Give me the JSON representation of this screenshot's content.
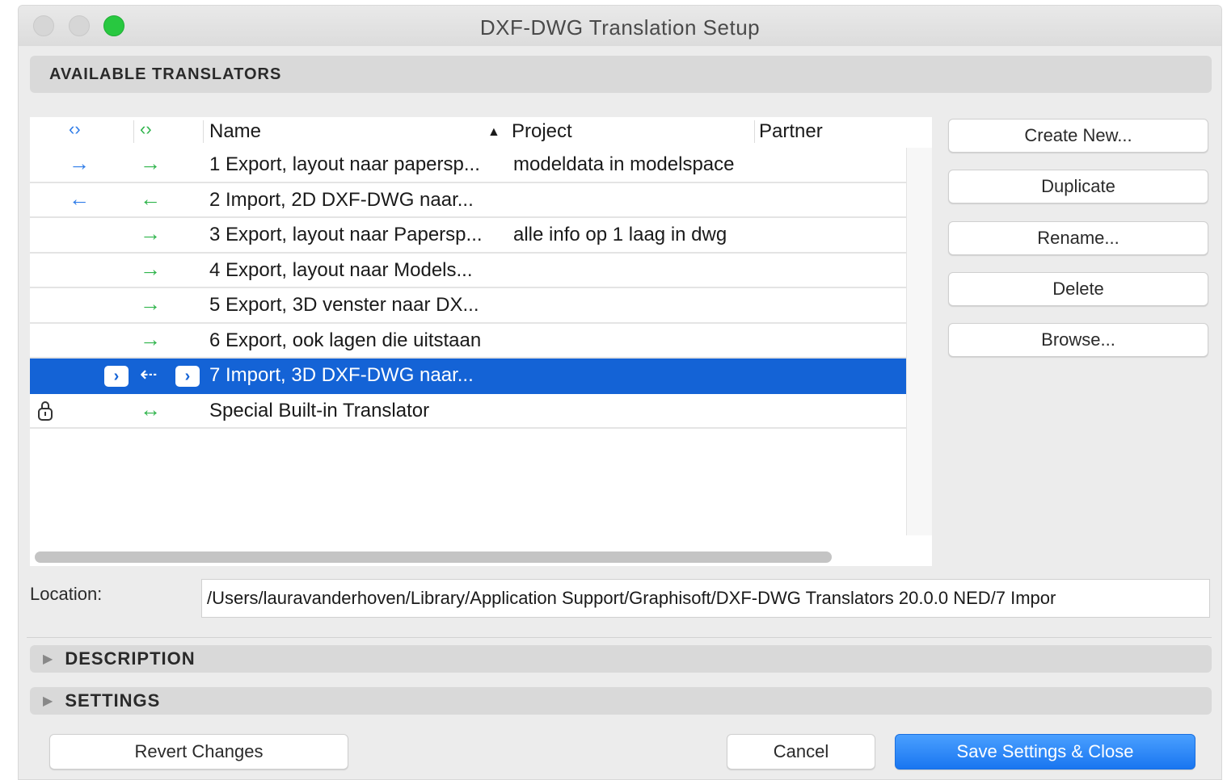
{
  "window": {
    "title": "DXF-DWG Translation Setup"
  },
  "translators": {
    "header": "AVAILABLE TRANSLATORS",
    "columns": {
      "icon1": "‹›",
      "icon2": "‹›",
      "name": "Name",
      "project": "Project",
      "partner": "Partner",
      "sort_indicator": "▲"
    },
    "rows": [
      {
        "dir1": "→",
        "dir2": "→",
        "name": "1 Export, layout naar papersp...",
        "project": "modeldata in modelspace"
      },
      {
        "dir1": "←",
        "dir2": "←",
        "name": "2 Import, 2D DXF-DWG naar...",
        "project": ""
      },
      {
        "dir1": "",
        "dir2": "→",
        "name": "3 Export, layout naar Papersp...",
        "project": "alle info op 1 laag in dwg"
      },
      {
        "dir1": "",
        "dir2": "→",
        "name": "4 Export, layout naar Models...",
        "project": ""
      },
      {
        "dir1": "",
        "dir2": "→",
        "name": "5 Export, 3D venster naar DX...",
        "project": ""
      },
      {
        "dir1": "",
        "dir2": "→",
        "name": "6 Export, ook lagen die uitstaan",
        "project": ""
      },
      {
        "dir1": "",
        "dir2": "⇠",
        "name": "7 Import, 3D DXF-DWG naar...",
        "project": "",
        "selected": true,
        "badge1": "›",
        "badge2": "›"
      },
      {
        "dir1": "",
        "dir2": "↔",
        "name": "Special Built-in Translator",
        "project": "",
        "lock_icon": "lock-icon"
      }
    ]
  },
  "side_buttons": {
    "create_new": "Create New...",
    "duplicate": "Duplicate",
    "rename": "Rename...",
    "delete": "Delete",
    "browse": "Browse..."
  },
  "location": {
    "label": "Location:",
    "value": "/Users/lauravanderhoven/Library/Application Support/Graphisoft/DXF-DWG Translators 20.0.0 NED/7 Impor"
  },
  "sections": {
    "description": "DESCRIPTION",
    "settings": "SETTINGS",
    "disclosure": "▶"
  },
  "footer": {
    "revert": "Revert Changes",
    "cancel": "Cancel",
    "save": "Save Settings & Close"
  },
  "colors": {
    "selection": "#1463d6",
    "export_arrow": "#2f7ce8",
    "import_arrow": "#2fb44b",
    "primary_button": "#1976f0"
  }
}
